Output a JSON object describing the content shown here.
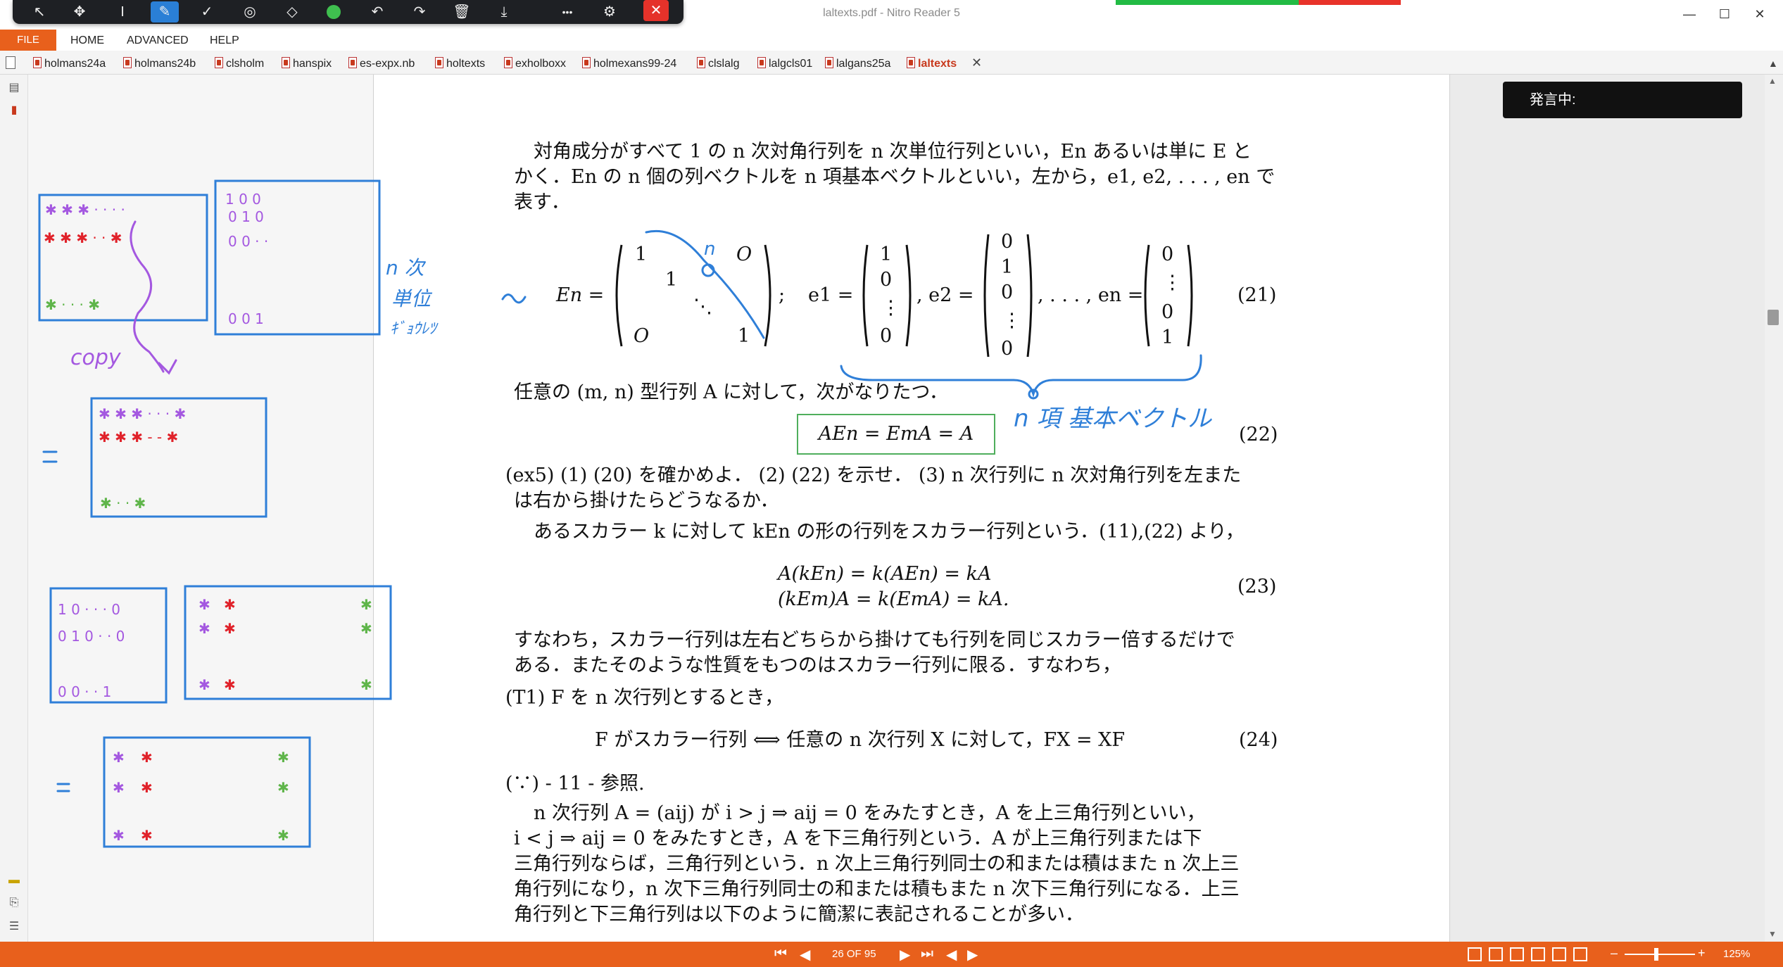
{
  "window": {
    "title": "laltexts.pdf - Nitro Reader 5",
    "minimize": "—",
    "maximize": "☐",
    "close": "✕"
  },
  "pen_toolbar": {
    "tools": [
      {
        "name": "select-arrow-icon",
        "glyph": "↖"
      },
      {
        "name": "move-icon",
        "glyph": "✥"
      },
      {
        "name": "text-cursor-icon",
        "glyph": "I"
      },
      {
        "name": "pen-icon",
        "glyph": "✎"
      },
      {
        "name": "check-icon",
        "glyph": "✓"
      },
      {
        "name": "target-icon",
        "glyph": "◎"
      },
      {
        "name": "eraser-icon",
        "glyph": "◇"
      },
      {
        "name": "color-dot-icon",
        "glyph": ""
      },
      {
        "name": "undo-icon",
        "glyph": "↶"
      },
      {
        "name": "redo-icon",
        "glyph": "↷"
      },
      {
        "name": "trash-icon",
        "glyph": "🗑"
      },
      {
        "name": "download-icon",
        "glyph": "⤓"
      },
      {
        "name": "more-icon",
        "glyph": "•••"
      },
      {
        "name": "user-settings-icon",
        "glyph": "⚙"
      }
    ],
    "close": "✕",
    "pen_color": "#3fbf4f"
  },
  "menu": {
    "file": "FILE",
    "items": [
      "HOME",
      "ADVANCED",
      "HELP"
    ]
  },
  "tabs": [
    "holmans24a",
    "holmans24b",
    "clsholm",
    "hanspix",
    "es-expx.nb",
    "holtexts",
    "exholboxx",
    "holmexans99-24",
    "clslalg",
    "lalgcls01",
    "lalgans25a",
    "laltexts"
  ],
  "active_tab": "laltexts",
  "speaking_label": "発言中:",
  "document": {
    "p1_l1": "対角成分がすべて 1 の n 次対角行列を n 次単位行列といい，En あるいは単に E と",
    "p1_l2": "かく．En の n 個の列ベクトルを n 項基本ベクトルといい，左から，e1, e2, . . . , en で",
    "p1_l3": "表す．",
    "eq21_lhs": "En =",
    "eq21_m1": "1",
    "eq21_m2": "1",
    "eq21_mO1": "O",
    "eq21_mO2": "O",
    "eq21_mdots": "⋱",
    "eq21_m3": "1",
    "eq21_e1": "e1 =",
    "eq21_e2": ", e2 =",
    "eq21_en": ", . . . , en =",
    "eq21_no": "(21)",
    "p2": "任意の (m, n) 型行列 A に対して，次がなりたつ．",
    "eq22": "AEn = EmA = A",
    "eq22_no": "(22)",
    "ex5_l1": "(ex5) (1) (20) を確かめよ． (2) (22) を示せ． (3) n 次行列に n 次対角行列を左また",
    "ex5_l2": "は右から掛けたらどうなるか．",
    "p3": "あるスカラー k に対して kEn の形の行列をスカラー行列という．(11),(22) より，",
    "eq23_l1": "A(kEn) = k(AEn) = kA",
    "eq23_l2": "(kEm)A = k(EmA) = kA.",
    "eq23_no": "(23)",
    "p4_l1": "すなわち，スカラー行列は左右どちらから掛けても行列を同じスカラー倍するだけで",
    "p4_l2": "ある．またそのような性質をもつのはスカラー行列に限る．すなわち，",
    "t1": "(T1) F を n 次行列とするとき，",
    "eq24": "F がスカラー行列 ⟺ 任意の n 次行列 X に対して，FX = XF",
    "eq24_no": "(24)",
    "because": "(∵) - 11 - 参照.",
    "p5_l1": "n 次行列 A = (aij) が i > j ⇒ aij = 0 をみたすとき，A を上三角行列といい，",
    "p5_l2": "i < j ⇒ aij = 0 をみたすとき，A を下三角行列という．A が上三角行列または下",
    "p5_l3": "三角行列ならば，三角行列という．n 次上三角行列同士の和または積はまた n 次上三",
    "p5_l4": "角行列になり，n 次下三角行列同士の和または積もまた n 次下三角行列になる．上三",
    "p5_l5": "角行列と下三角行列は以下のように簡潔に表記されることが多い．"
  },
  "vectors": {
    "e1": [
      "1",
      "0",
      "⋮",
      "0"
    ],
    "e2": [
      "0",
      "1",
      "0",
      "⋮",
      "0"
    ],
    "en": [
      "0",
      "⋮",
      "0",
      "1"
    ]
  },
  "handwriting": {
    "n_label": "n",
    "n_ji": "n 次",
    "tani": "単位",
    "gyouretsu": "ｷﾞｮｳﾚﾂ",
    "copy": "copy",
    "kihon": "n 項 基本ベクトル",
    "eq1": "=",
    "eq2": "="
  },
  "statusbar": {
    "page": "26 OF 95",
    "zoom": "125%",
    "first": "⏮",
    "prev": "◀",
    "next": "▶",
    "last": "⏭"
  },
  "colors": {
    "accent": "#e8601c",
    "ink_blue": "#2f7fd8",
    "ink_purple": "#a458e0",
    "ink_red": "#e0222a",
    "ink_green": "#5fb54a",
    "box_green": "#4fae5c"
  }
}
